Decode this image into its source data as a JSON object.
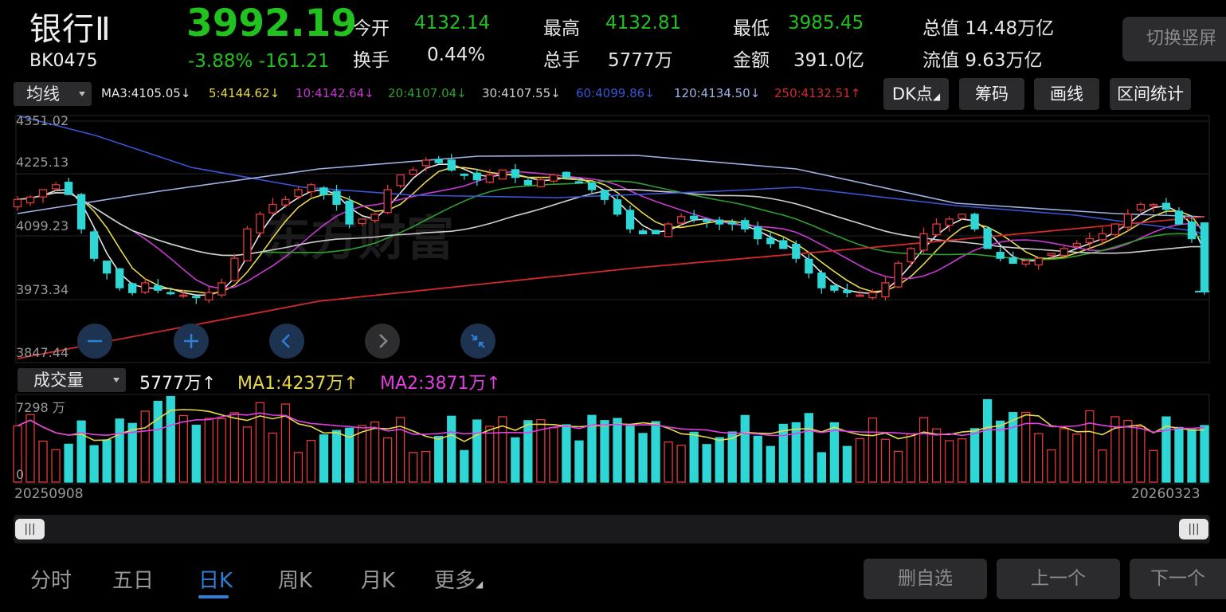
{
  "stock": {
    "name": "银行Ⅱ",
    "code": "BK0475",
    "price": "3992.19",
    "change_pct": "-3.88%",
    "change_abs": "-161.21",
    "switch_button": "切换竖屏"
  },
  "quote": {
    "open_label": "今开",
    "open": "4132.14",
    "high_label": "最高",
    "high": "4132.81",
    "low_label": "最低",
    "low": "3985.45",
    "turnover_label": "换手",
    "turnover": "0.44%",
    "volume_label": "总手",
    "volume": "5777万",
    "amount_label": "金额",
    "amount": "391.0亿",
    "total_mv_label": "总值",
    "total_mv": "14.48万亿",
    "float_mv_label": "流值",
    "float_mv": "9.63万亿"
  },
  "indicator": {
    "selector": "均线",
    "ma": [
      {
        "text": "MA3:4105.05↓",
        "color": "#e6e6e6"
      },
      {
        "text": "5:4144.62↓",
        "color": "#e8d84a"
      },
      {
        "text": "10:4142.64↓",
        "color": "#c63ad0"
      },
      {
        "text": "20:4107.04↓",
        "color": "#2fa02f"
      },
      {
        "text": "30:4107.55↓",
        "color": "#cfcfcf"
      },
      {
        "text": "60:4099.86↓",
        "color": "#3a56d6"
      },
      {
        "text": "120:4134.50↓",
        "color": "#9fb2e6"
      },
      {
        "text": "250:4132.51↑",
        "color": "#d22a2a"
      }
    ],
    "buttons": [
      "DK点",
      "筹码",
      "画线",
      "区间统计"
    ]
  },
  "chart_data": {
    "type": "candlestick",
    "y_ticks": [
      "4351.02",
      "4225.13",
      "4099.23",
      "3973.34",
      "3847.44"
    ],
    "ylim": [
      3847.44,
      4351.02
    ],
    "x_range": [
      "20250908",
      "20260323"
    ],
    "last_candle": {
      "open": 4132.14,
      "high": 4132.81,
      "low": 3985.45,
      "close": 3992.19
    },
    "close_trend": [
      4180,
      4185,
      4200,
      4210,
      4190,
      4120,
      4060,
      4030,
      4000,
      3990,
      4010,
      3995,
      3990,
      3985,
      3980,
      3990,
      4010,
      4060,
      4120,
      4150,
      4170,
      4180,
      4200,
      4210,
      4190,
      4170,
      4130,
      4140,
      4150,
      4200,
      4230,
      4240,
      4260,
      4255,
      4240,
      4230,
      4220,
      4230,
      4240,
      4225,
      4210,
      4220,
      4230,
      4225,
      4215,
      4200,
      4180,
      4150,
      4120,
      4110,
      4110,
      4130,
      4145,
      4140,
      4135,
      4130,
      4130,
      4120,
      4100,
      4090,
      4080,
      4060,
      4030,
      4000,
      3995,
      3990,
      3985,
      3990,
      4010,
      4050,
      4080,
      4110,
      4130,
      4140,
      4150,
      4120,
      4080,
      4060,
      4050,
      4055,
      4060,
      4070,
      4080,
      4090,
      4100,
      4110,
      4130,
      4150,
      4170,
      4170,
      4160,
      4130,
      4100,
      3992.19
    ]
  },
  "volume": {
    "selector": "成交量",
    "current": "5777万↑",
    "ma1": "MA1:4237万↑",
    "ma2": "MA2:3871万↑",
    "y_max": "7298 万",
    "y_min": "0",
    "date_start": "20250908",
    "date_end": "20260323"
  },
  "period_tabs": [
    "分时",
    "五日",
    "日K",
    "周K",
    "月K",
    "更多"
  ],
  "active_tab": "日K",
  "bottom_buttons": [
    "删自选",
    "上一个",
    "下一个"
  ],
  "colors": {
    "up": "#e23a3a",
    "down": "#2fd6d6",
    "green_text": "#21c21d",
    "active_tab": "#2e7fd8"
  }
}
